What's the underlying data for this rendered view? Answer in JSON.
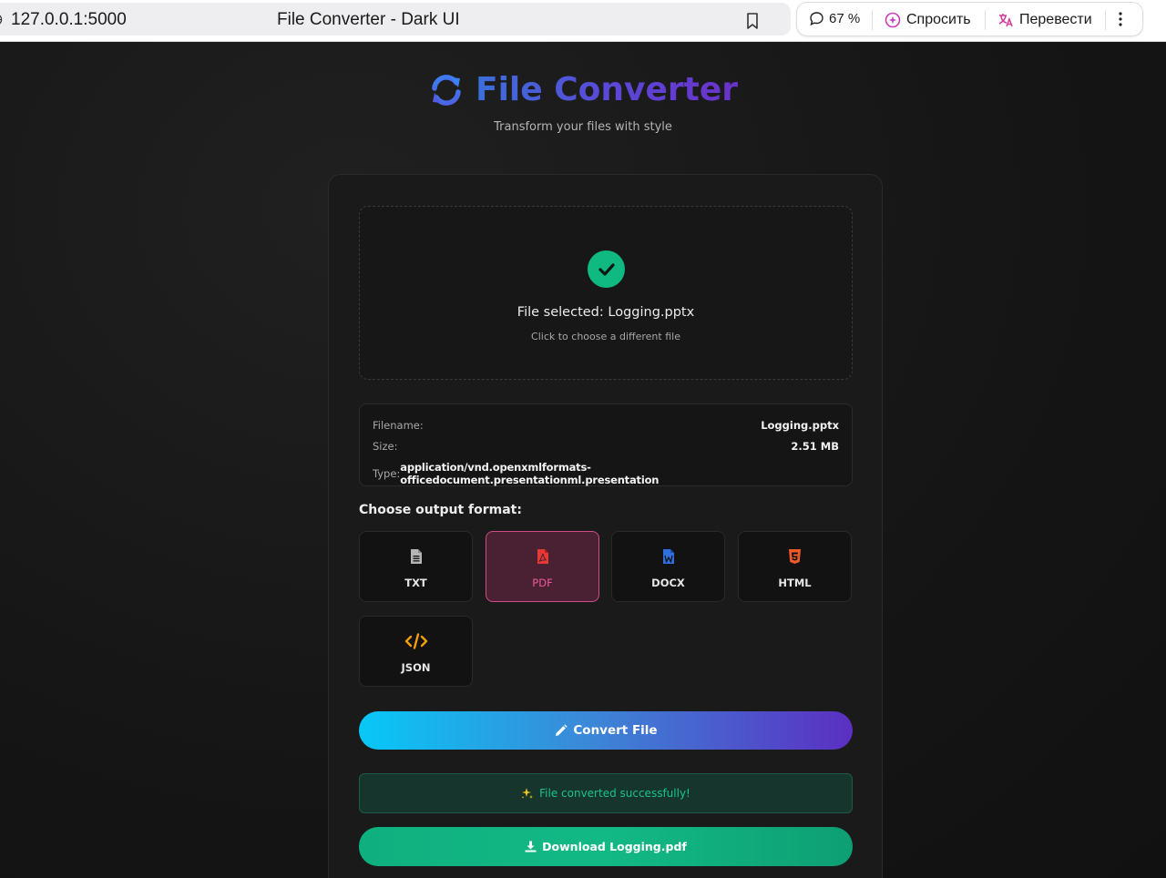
{
  "browser": {
    "url": "127.0.0.1:5000",
    "tab_title": "File Converter - Dark UI",
    "zoom": "67 %",
    "ask_label": "Спросить",
    "translate_label": "Перевести"
  },
  "header": {
    "title": "File Converter",
    "subtitle": "Transform your files with style",
    "icon": "sync-icon"
  },
  "dropzone": {
    "status": "File selected: Logging.pptx",
    "hint": "Click to choose a different file"
  },
  "file_info": {
    "filename_label": "Filename:",
    "filename": "Logging.pptx",
    "size_label": "Size:",
    "size": "2.51 MB",
    "type_label": "Type:",
    "type": "application/vnd.openxmlformats-officedocument.presentationml.presentation"
  },
  "formats": {
    "label": "Choose output format:",
    "selected": "PDF",
    "items": [
      {
        "label": "TXT",
        "icon": "text-file-icon",
        "color": "#b5b5b5"
      },
      {
        "label": "PDF",
        "icon": "pdf-file-icon",
        "color": "#e53935"
      },
      {
        "label": "DOCX",
        "icon": "word-file-icon",
        "color": "#2f6fe0"
      },
      {
        "label": "HTML",
        "icon": "html5-icon",
        "color": "#ef5a2a"
      },
      {
        "label": "JSON",
        "icon": "code-icon",
        "color": "#f59e0b"
      }
    ]
  },
  "actions": {
    "convert_label": "Convert File",
    "success_message": "File converted successfully!",
    "download_label": "Download Logging.pdf"
  },
  "colors": {
    "accent_success": "#10b981",
    "selected_border": "#d14c88"
  }
}
